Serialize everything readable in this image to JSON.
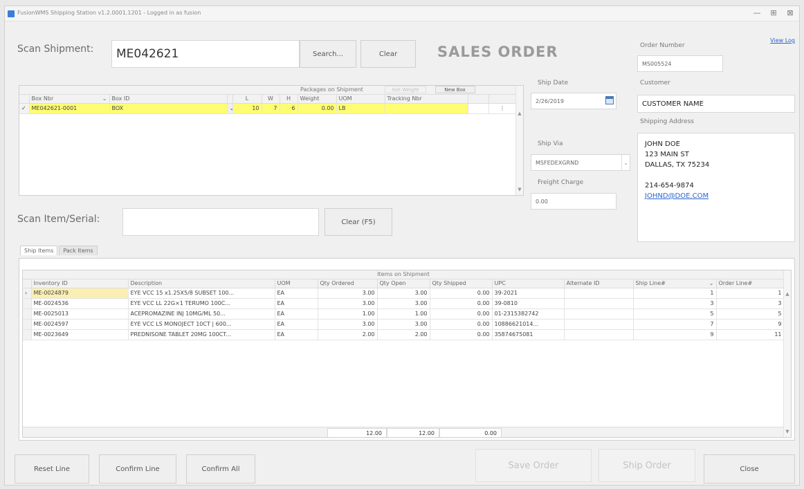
{
  "window": {
    "title": "FusionWMS Shipping Station v1.2.0001.1201 - Logged in as fusion",
    "minimize": "—",
    "maximize": "⊞",
    "close": "⊠"
  },
  "view_log": "View Log",
  "scan_shipment": {
    "label": "Scan Shipment:",
    "value": "ME042621",
    "search_button": "Search...",
    "clear_button": "Clear"
  },
  "heading": "SALES ORDER",
  "order_number": {
    "label": "Order Number",
    "value": "MS005524"
  },
  "customer": {
    "label": "Customer",
    "value": "CUSTOMER NAME"
  },
  "shipping_address": {
    "label": "Shipping Address",
    "lines": [
      "JOHN DOE",
      "123 MAIN ST",
      "DALLAS, TX 75234",
      "",
      "214-654-9874"
    ],
    "email": "JOHND@DOE.COM"
  },
  "ship_date": {
    "label": "Ship Date",
    "value": "2/26/2019"
  },
  "ship_via": {
    "label": "Ship Via",
    "value": "MSFEDEXGRND"
  },
  "freight_charge": {
    "label": "Freight Charge",
    "value": "0.00"
  },
  "packages": {
    "group_title": "Packages on Shipment",
    "get_weight_button": "Get Weight",
    "new_box_button": "New Box",
    "columns": [
      "Box Nbr",
      "Box ID",
      "L",
      "W",
      "H",
      "Weight",
      "UOM",
      "Tracking Nbr"
    ],
    "rows": [
      {
        "box_nbr": "ME042621-0001",
        "box_id": "BOX",
        "l": "10",
        "w": "7",
        "h": "6",
        "weight": "0.00",
        "uom": "LB",
        "tracking": ""
      }
    ]
  },
  "scan_item": {
    "label": "Scan Item/Serial:",
    "value": "",
    "clear_button": "Clear (F5)"
  },
  "tabs": [
    {
      "label": "Ship Items"
    },
    {
      "label": "Pack Items"
    }
  ],
  "items": {
    "group_title": "Items on Shipment",
    "columns": [
      "Inventory ID",
      "Description",
      "UOM",
      "Qty Ordered",
      "Qty Open",
      "Qty Shipped",
      "UPC",
      "Alternate ID",
      "Ship Line#",
      "Order Line#"
    ],
    "rows": [
      {
        "inventory_id": "ME-0024879",
        "description": "EYE VCC 15 x1.25X5/8 SUBSET 100...",
        "uom": "EA",
        "qty_ordered": "3.00",
        "qty_open": "3.00",
        "qty_shipped": "0.00",
        "upc": "39-2021",
        "alternate_id": "",
        "ship_line": "1",
        "order_line": "1"
      },
      {
        "inventory_id": "ME-0024536",
        "description": "EYE VCC LL 22G×1 TERUMO 100C...",
        "uom": "EA",
        "qty_ordered": "3.00",
        "qty_open": "3.00",
        "qty_shipped": "0.00",
        "upc": "39-0810",
        "alternate_id": "",
        "ship_line": "3",
        "order_line": "3"
      },
      {
        "inventory_id": "ME-0025013",
        "description": "ACEPROMAZINE INJ 10MG/ML 50...",
        "uom": "EA",
        "qty_ordered": "1.00",
        "qty_open": "1.00",
        "qty_shipped": "0.00",
        "upc": "01-2315382742",
        "alternate_id": "",
        "ship_line": "5",
        "order_line": "5"
      },
      {
        "inventory_id": "ME-0024597",
        "description": "EYE VCC LS MONOJECT 10CT | 600...",
        "uom": "EA",
        "qty_ordered": "3.00",
        "qty_open": "3.00",
        "qty_shipped": "0.00",
        "upc": "10886621014...",
        "alternate_id": "",
        "ship_line": "7",
        "order_line": "9"
      },
      {
        "inventory_id": "ME-0023649",
        "description": "PREDNISONE TABLET 20MG 100CT...",
        "uom": "EA",
        "qty_ordered": "2.00",
        "qty_open": "2.00",
        "qty_shipped": "0.00",
        "upc": "35874675081",
        "alternate_id": "",
        "ship_line": "9",
        "order_line": "11"
      }
    ],
    "totals": {
      "qty_ordered": "12.00",
      "qty_open": "12.00",
      "qty_shipped": "0.00"
    }
  },
  "footer": {
    "reset_line": "Reset Line",
    "confirm_line": "Confirm Line",
    "confirm_all": "Confirm All",
    "save_order": "Save Order",
    "ship_order": "Ship Order",
    "close": "Close"
  }
}
